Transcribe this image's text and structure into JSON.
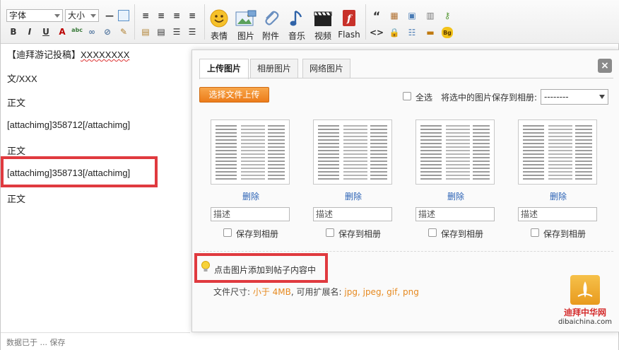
{
  "toolbar": {
    "font_select": "字体",
    "size_select": "大小",
    "big_buttons": [
      {
        "label": "表情",
        "icon": "smiley-icon"
      },
      {
        "label": "图片",
        "icon": "picture-icon"
      },
      {
        "label": "附件",
        "icon": "paperclip-icon"
      },
      {
        "label": "音乐",
        "icon": "music-note-icon"
      },
      {
        "label": "视频",
        "icon": "video-clapper-icon"
      },
      {
        "label": "Flash",
        "icon": "flash-icon"
      }
    ]
  },
  "editor": {
    "lines": [
      {
        "prefix": "【迪拜游记投稿】",
        "spell": "XXXXXXXX"
      },
      {
        "text": "文/XXX"
      },
      {
        "text": "正文"
      },
      {
        "text": "[attachimg]358712[/attachimg]"
      },
      {
        "text": "正文"
      },
      {
        "text": "[attachimg]358713[/attachimg]"
      },
      {
        "text": "正文"
      }
    ],
    "status": "数据已于 ... 保存"
  },
  "dialog": {
    "tabs": [
      "上传图片",
      "相册图片",
      "网络图片"
    ],
    "close": "×",
    "upload_button": "选择文件上传",
    "select_all": "全选",
    "save_to_album_label": "将选中的图片保存到相册:",
    "album_value": "--------",
    "cards": [
      {
        "delete": "删除",
        "desc_placeholder": "描述",
        "save": "保存到相册"
      },
      {
        "delete": "删除",
        "desc_placeholder": "描述",
        "save": "保存到相册"
      },
      {
        "delete": "删除",
        "desc_placeholder": "描述",
        "save": "保存到相册"
      },
      {
        "delete": "删除",
        "desc_placeholder": "描述",
        "save": "保存到相册"
      }
    ],
    "hint": "点击图片添加到帖子内容中",
    "file_size_label": "文件尺寸: ",
    "file_size_value": "小于 4MB",
    "ext_label": ", 可用扩展名: ",
    "ext_value": "jpg, jpeg, gif, png"
  },
  "watermark": {
    "cn": "迪拜中华网",
    "en": "dibaichina.com"
  },
  "colors": {
    "highlight_box": "#e03a3f",
    "upload_orange": "#ec7c1a",
    "link_blue": "#2a62b5",
    "file_orange": "#e6891f"
  }
}
